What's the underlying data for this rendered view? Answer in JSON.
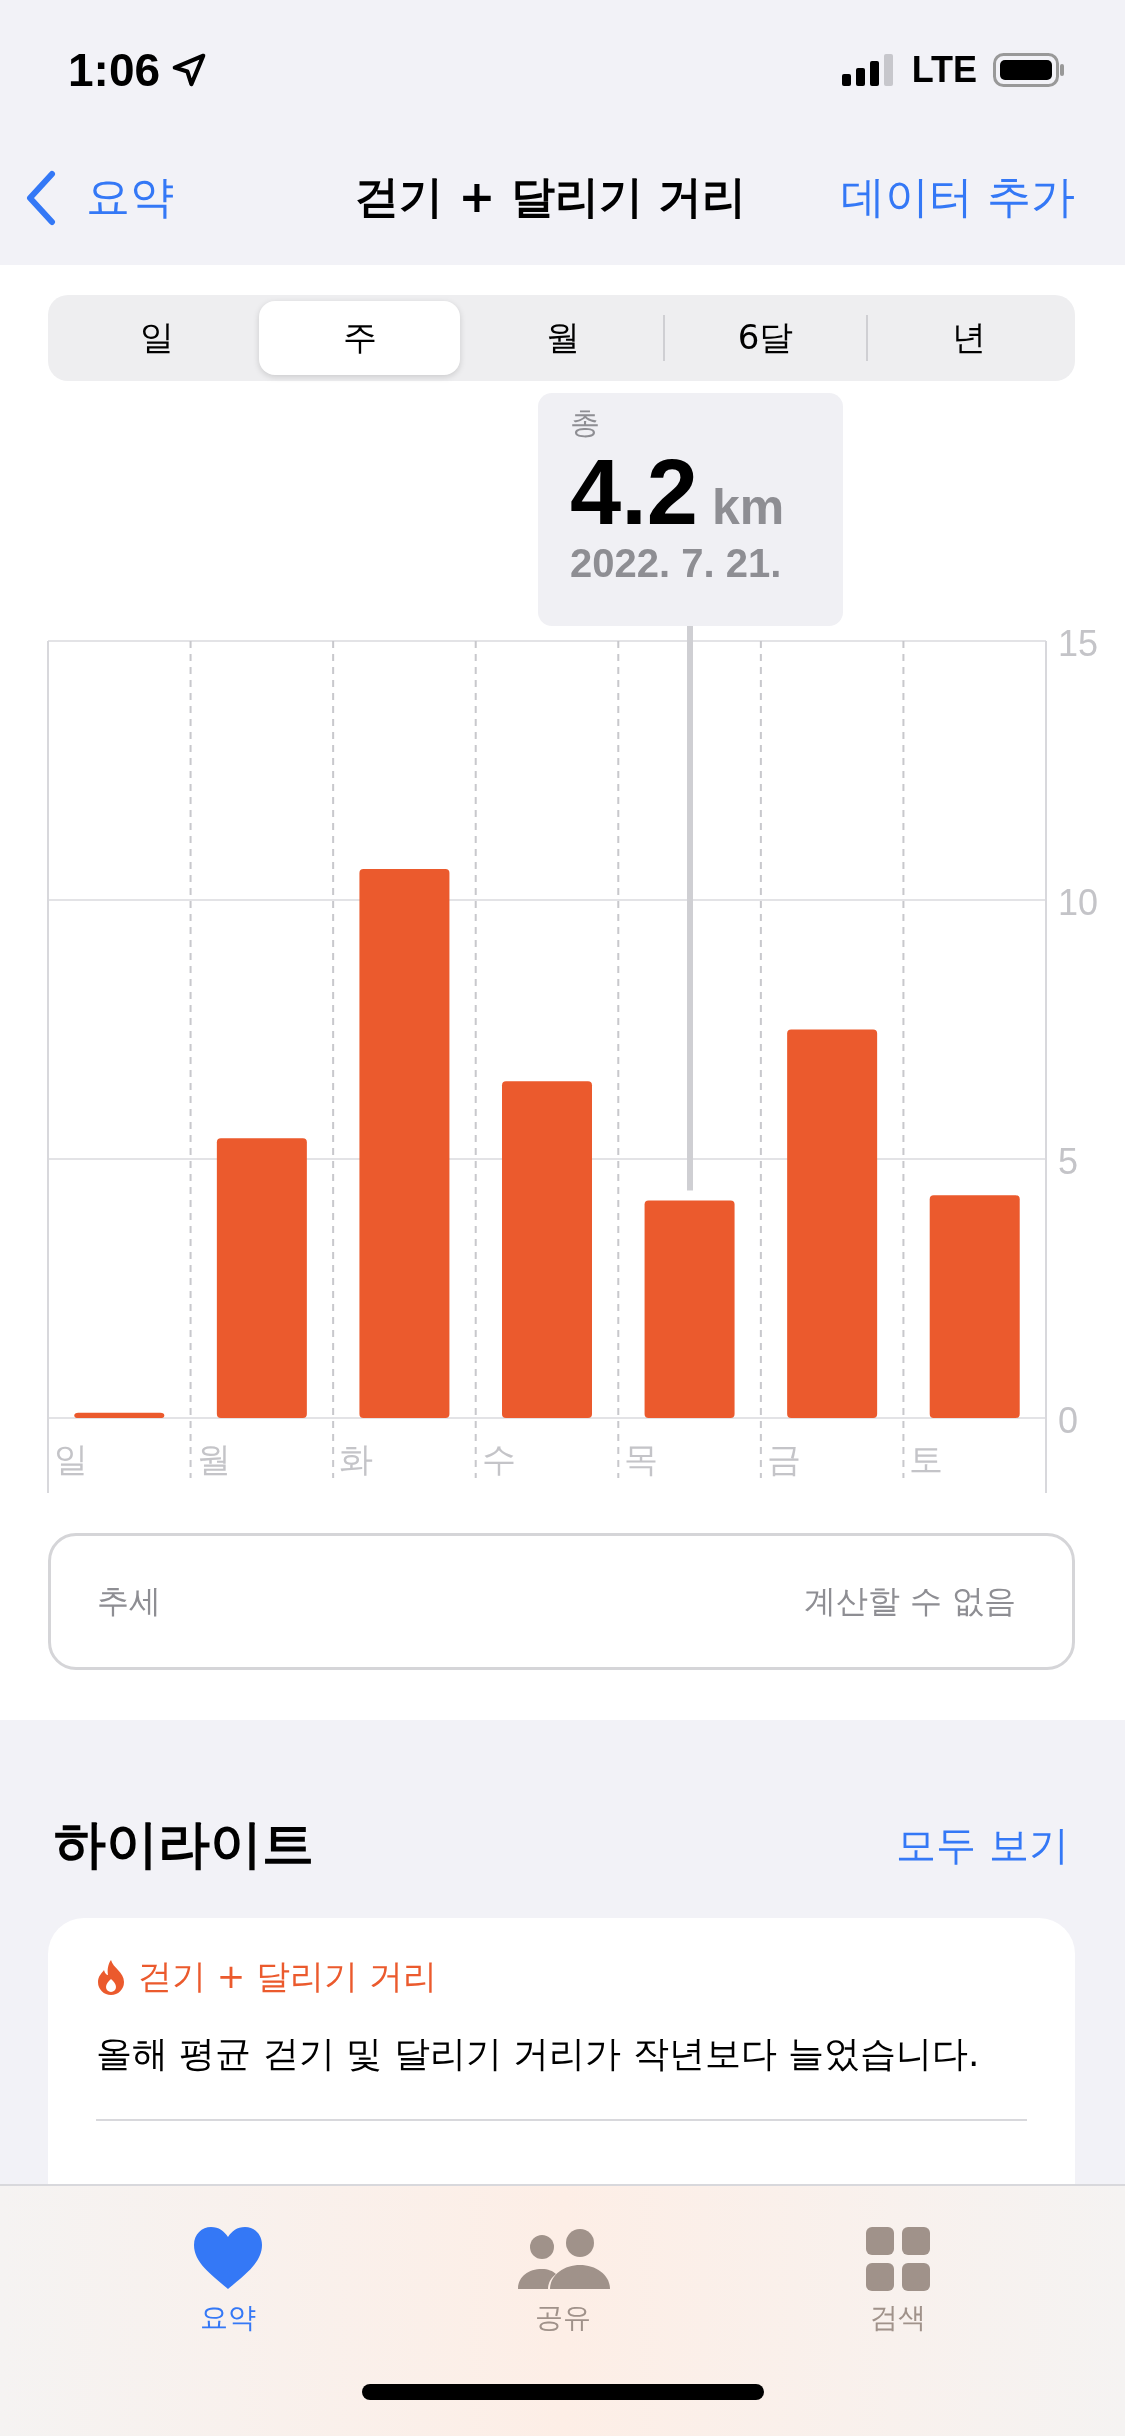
{
  "status_bar": {
    "time": "1:06",
    "network": "LTE"
  },
  "nav": {
    "back": "요약",
    "title": "걷기 + 달리기 거리",
    "action": "데이터 추가"
  },
  "segments": [
    {
      "label": "일",
      "selected": false
    },
    {
      "label": "주",
      "selected": true
    },
    {
      "label": "월",
      "selected": false
    },
    {
      "label": "6달",
      "selected": false
    },
    {
      "label": "년",
      "selected": false
    }
  ],
  "tooltip": {
    "label": "총",
    "value": "4.2",
    "unit": "km",
    "date": "2022. 7. 21."
  },
  "chart_data": {
    "type": "bar",
    "categories": [
      "일",
      "월",
      "화",
      "수",
      "목",
      "금",
      "토"
    ],
    "series": [
      {
        "color": "#eb5a2d",
        "values": [
          0.1,
          5.4,
          10.6,
          6.5,
          4.2,
          7.5,
          4.3
        ]
      }
    ],
    "ylim": [
      0,
      15
    ],
    "yticks": [
      0,
      5,
      10,
      15
    ]
  },
  "trend": {
    "label": "추세",
    "value": "계산할 수 없음"
  },
  "highlights": {
    "title": "하이라이트",
    "link": "모두 보기",
    "card": {
      "category": "걷기 + 달리기 거리",
      "text": "올해 평균 걷기 및 달리기 거리가 작년보다 늘었습니다."
    }
  },
  "tab_bar": [
    {
      "kind": "heart",
      "label": "요약",
      "selected": true
    },
    {
      "kind": "people",
      "label": "공유",
      "selected": false
    },
    {
      "kind": "grid",
      "label": "검색",
      "selected": false
    }
  ]
}
